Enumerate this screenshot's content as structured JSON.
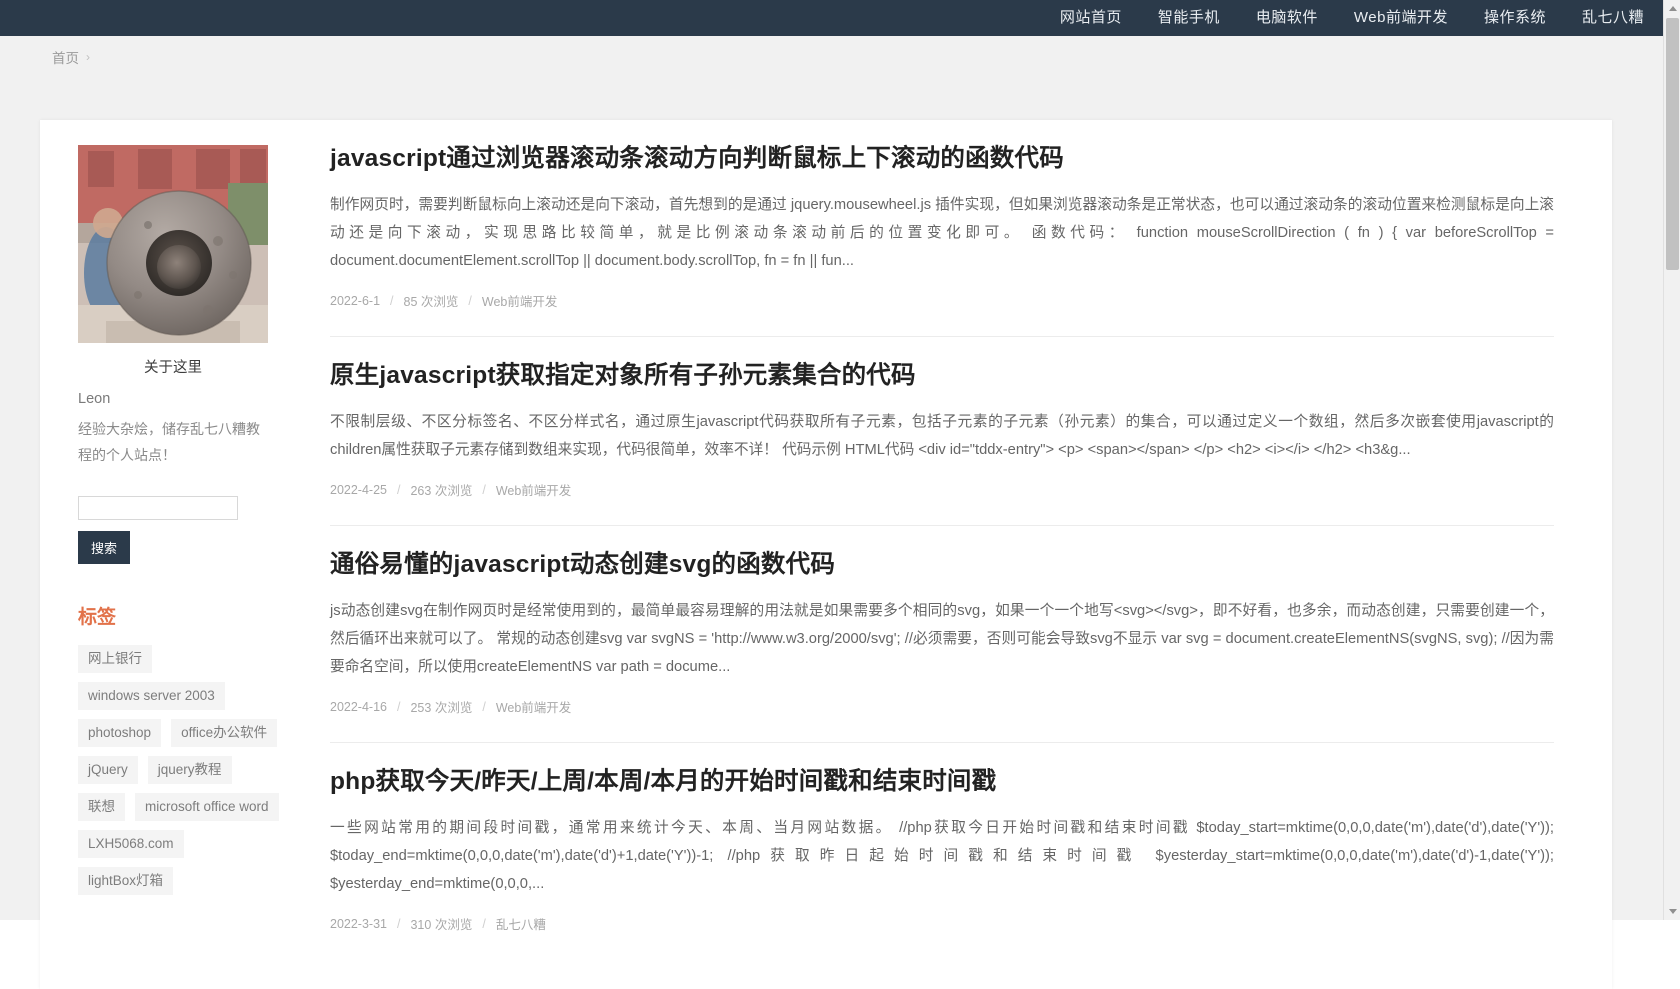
{
  "nav": {
    "items": [
      {
        "label": "网站首页",
        "name": "nav-home"
      },
      {
        "label": "智能手机",
        "name": "nav-smartphone"
      },
      {
        "label": "电脑软件",
        "name": "nav-software"
      },
      {
        "label": "Web前端开发",
        "name": "nav-web-frontend"
      },
      {
        "label": "操作系统",
        "name": "nav-os"
      },
      {
        "label": "乱七八糟",
        "name": "nav-misc"
      }
    ]
  },
  "breadcrumb": {
    "home": "首页",
    "separator": "›"
  },
  "sidebar": {
    "about_title": "关于这里",
    "author": "Leon",
    "description": "经验大杂烩，储存乱七八糟教程的个人站点！",
    "avatar_alt": "stone-cannon-photo",
    "search": {
      "value": "",
      "placeholder": "",
      "button_label": "搜索"
    },
    "tags_title": "标签",
    "tags": [
      "网上银行",
      "windows server 2003",
      "photoshop",
      "office办公软件",
      "jQuery",
      "jquery教程",
      "联想",
      "microsoft office word",
      "LXH5068.com",
      "lightBox灯箱"
    ]
  },
  "posts": [
    {
      "title": "javascript通过浏览器滚动条滚动方向判断鼠标上下滚动的函数代码",
      "excerpt": "制作网页时，需要判断鼠标向上滚动还是向下滚动，首先想到的是通过 jquery.mousewheel.js 插件实现，但如果浏览器滚动条是正常状态，也可以通过滚动条的滚动位置来检测鼠标是向上滚动还是向下滚动，实现思路比较简单，就是比例滚动条滚动前后的位置变化即可。 函数代码： function mouseScrollDirection ( fn ) { var beforeScrollTop = document.documentElement.scrollTop || document.body.scrollTop, fn = fn || fun...",
      "date": "2022-6-1",
      "views": "85 次浏览",
      "category": "Web前端开发"
    },
    {
      "title": "原生javascript获取指定对象所有子孙元素集合的代码",
      "excerpt": "不限制层级、不区分标签名、不区分样式名，通过原生javascript代码获取所有子元素，包括子元素的子元素（孙元素）的集合，可以通过定义一个数组，然后多次嵌套使用javascript的children属性获取子元素存储到数组来实现，代码很简单，效率不详！ 代码示例 HTML代码 <div id=\"tddx-entry\"> <p> <span></span> </p> <h2> <i></i> </h2> <h3&g...",
      "date": "2022-4-25",
      "views": "263 次浏览",
      "category": "Web前端开发"
    },
    {
      "title": "通俗易懂的javascript动态创建svg的函数代码",
      "excerpt": "js动态创建svg在制作网页时是经常使用到的，最简单最容易理解的用法就是如果需要多个相同的svg，如果一个一个地写<svg></svg>，即不好看，也多余，而动态创建，只需要创建一个，然后循环出来就可以了。 常规的动态创建svg var svgNS = 'http://www.w3.org/2000/svg'; //必须需要，否则可能会导致svg不显示 var svg = document.createElementNS(svgNS, svg); //因为需要命名空间，所以使用createElementNS var path = docume...",
      "date": "2022-4-16",
      "views": "253 次浏览",
      "category": "Web前端开发"
    },
    {
      "title": "php获取今天/昨天/上周/本周/本月的开始时间戳和结束时间戳",
      "excerpt": "一些网站常用的期间段时间戳，通常用来统计今天、本周、当月网站数据。 //php获取今日开始时间戳和结束时间戳 $today_start=mktime(0,0,0,date('m'),date('d'),date('Y')); $today_end=mktime(0,0,0,date('m'),date('d')+1,date('Y'))-1; //php获取昨日起始时间戳和结束时间戳 $yesterday_start=mktime(0,0,0,date('m'),date('d')-1,date('Y')); $yesterday_end=mktime(0,0,0,...",
      "date": "2022-3-31",
      "views": "310 次浏览",
      "category": "乱七八糟"
    }
  ],
  "meta_separator": "/",
  "colors": {
    "nav_bg": "#2b3a4a",
    "accent": "#e2724a",
    "page_bg": "#f1f1f1",
    "text": "#222222",
    "muted": "#a8a8a8"
  }
}
